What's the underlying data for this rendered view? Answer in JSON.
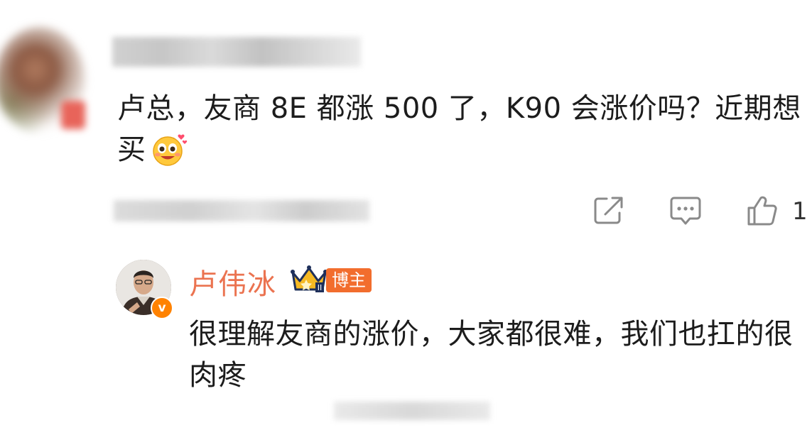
{
  "comment": {
    "text": "卢总，友商 8E 都涨 500 了，K90 会涨价吗？近期想买",
    "emoji": "happy-face-emoji"
  },
  "actions": {
    "share_icon": "share-icon",
    "comment_icon": "comment-icon",
    "like_icon": "thumbs-up-icon",
    "like_count": "1"
  },
  "reply": {
    "author": "卢伟冰",
    "verified_mark": "v",
    "role_badge": "博主",
    "text": "很理解友商的涨价，大家都很难，我们也扛的很肉疼"
  },
  "colors": {
    "author_name": "#eb7350",
    "role_badge_bg": "#f26d2d",
    "verified_badge": "#ff8200",
    "text": "#1c1c1c",
    "icon_gray": "#8a8a8a"
  }
}
